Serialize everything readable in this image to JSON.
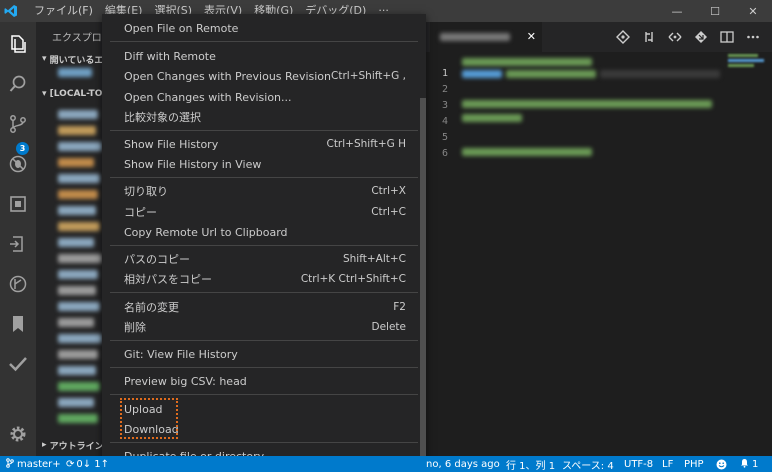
{
  "menubar": {
    "items": [
      {
        "label": "ファイル(F)"
      },
      {
        "label": "編集(E)"
      },
      {
        "label": "選択(S)"
      },
      {
        "label": "表示(V)"
      },
      {
        "label": "移動(G)"
      },
      {
        "label": "デバッグ(D)"
      },
      {
        "label": "···"
      }
    ]
  },
  "window": {
    "minimize": "—",
    "maximize": "☐",
    "close": "✕"
  },
  "activity": {
    "scm_badge": "3"
  },
  "sidebar": {
    "title": "エクスプロー",
    "open_editors": "開いているエ",
    "folder": "[LOCAL-TO-",
    "outline": "アウトライン"
  },
  "tabs": {
    "close": "✕"
  },
  "editor": {
    "line_numbers": [
      "1",
      "2",
      "3",
      "4",
      "5",
      "6"
    ]
  },
  "context_menu": {
    "items": [
      {
        "label": "Open File on Remote",
        "shortcut": ""
      },
      {
        "label": "Diff with Remote",
        "shortcut": ""
      },
      {
        "label": "Open Changes with Previous Revision",
        "shortcut": "Ctrl+Shift+G ,"
      },
      {
        "label": "Open Changes with Revision...",
        "shortcut": ""
      },
      {
        "label": "比較対象の選択",
        "shortcut": ""
      },
      {
        "label": "Show File History",
        "shortcut": "Ctrl+Shift+G H"
      },
      {
        "label": "Show File History in View",
        "shortcut": ""
      },
      {
        "label": "切り取り",
        "shortcut": "Ctrl+X"
      },
      {
        "label": "コピー",
        "shortcut": "Ctrl+C"
      },
      {
        "label": "Copy Remote Url to Clipboard",
        "shortcut": ""
      },
      {
        "label": "パスのコピー",
        "shortcut": "Shift+Alt+C"
      },
      {
        "label": "相対パスをコピー",
        "shortcut": "Ctrl+K Ctrl+Shift+C"
      },
      {
        "label": "名前の変更",
        "shortcut": "F2"
      },
      {
        "label": "削除",
        "shortcut": "Delete"
      },
      {
        "label": "Git: View File History",
        "shortcut": ""
      },
      {
        "label": "Preview big CSV: head",
        "shortcut": ""
      },
      {
        "label": "Upload",
        "shortcut": ""
      },
      {
        "label": "Download",
        "shortcut": ""
      },
      {
        "label": "Duplicate file or directory",
        "shortcut": ""
      }
    ]
  },
  "statusbar": {
    "branch": "master+",
    "sync": "0↓ 1↑",
    "blame": "no, 6 days ago",
    "position": "行 1、列 1",
    "spaces": "スペース: 4",
    "encoding": "UTF-8",
    "eol": "LF",
    "language": "PHP",
    "feedback_icon": "smiley-icon",
    "notifications": "1"
  }
}
